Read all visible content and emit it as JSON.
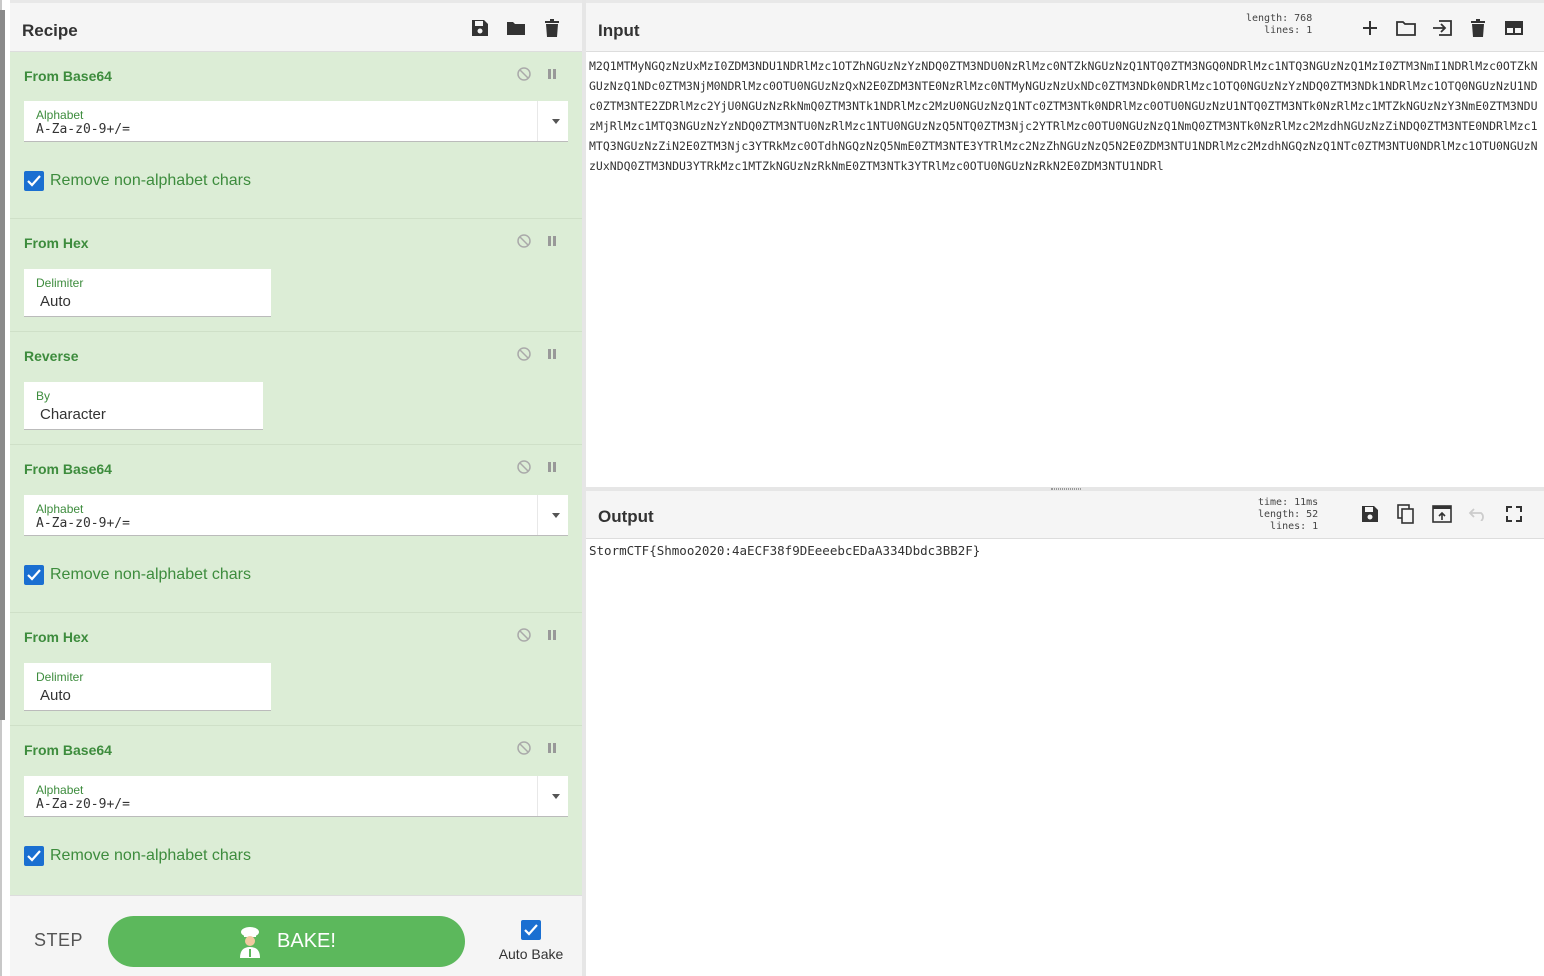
{
  "recipe": {
    "title": "Recipe",
    "operations": [
      {
        "name": "From Base64",
        "field_label": "Alphabet",
        "field_value": "A-Za-z0-9+/=",
        "checkbox_label": "Remove non-alphabet chars"
      },
      {
        "name": "From Hex",
        "field_label": "Delimiter",
        "field_value": "Auto"
      },
      {
        "name": "Reverse",
        "field_label": "By",
        "field_value": "Character"
      },
      {
        "name": "From Base64",
        "field_label": "Alphabet",
        "field_value": "A-Za-z0-9+/=",
        "checkbox_label": "Remove non-alphabet chars"
      },
      {
        "name": "From Hex",
        "field_label": "Delimiter",
        "field_value": "Auto"
      },
      {
        "name": "From Base64",
        "field_label": "Alphabet",
        "field_value": "A-Za-z0-9+/=",
        "checkbox_label": "Remove non-alphabet chars"
      }
    ],
    "step_label": "STEP",
    "bake_label": "BAKE!",
    "auto_bake_label": "Auto Bake",
    "auto_bake_checked": true
  },
  "input": {
    "title": "Input",
    "length_label": "length:",
    "length_value": "768",
    "lines_label": "lines:",
    "lines_value": "1",
    "text": "M2Q1MTMyNGQzNzUxMzI0ZDM3NDU1NDRlMzc1OTZhNGUzNzYzNDQ0ZTM3NDU0NzRlMzc0NTZkNGUzNzQ1NTQ0ZTM3NGQ0NDRlMzc1NTQ3NGUzNzQ1MzI0ZTM3NmI1NDRlMzc0OTZkNGUzNzQ1NDc0ZTM3NjM0NDRlMzc0OTU0NGUzNzQxN2E0ZDM3NTE0NzRlMzc0NTMyNGUzNzUxNDc0ZTM3NDk0NDRlMzc1OTQ0NGUzNzYzNDQ0ZTM3NDk1NDRlMzc1OTQ0NGUzNzU1NDc0ZTM3NTE2ZDRlMzc2YjU0NGUzNzRkNmQ0ZTM3NTk1NDRlMzc2MzU0NGUzNzQ1NTc0ZTM3NTk0NDRlMzc0OTU0NGUzNzU1NTQ0ZTM3NTk0NzRlMzc1MTZkNGUzNzY3NmE0ZTM3NDUzMjRlMzc1MTQ3NGUzNzYzNDQ0ZTM3NTU0NzRlMzc1NTU0NGUzNzQ5NTQ0ZTM3Njc2YTRlMzc0OTU0NGUzNzQ1NmQ0ZTM3NTk0NzRlMzc2MzdhNGUzNzZiNDQ0ZTM3NTE0NDRlMzc1MTQ3NGUzNzZiN2E0ZTM3Njc3YTRkMzc0OTdhNGQzNzQ5NmE0ZTM3NTE3YTRlMzc2NzZhNGUzNzQ5N2E0ZDM3NTU1NDRlMzc2MzdhNGQzNzQ1NTc0ZTM3NTU0NDRlMzc1OTU0NGUzNzUxNDQ0ZTM3NDU3YTRkMzc1MTZkNGUzNzRkNmE0ZTM3NTk3YTRlMzc0OTU0NGUzNzRkN2E0ZDM3NTU1NDRl"
  },
  "output": {
    "title": "Output",
    "time_label": "time:",
    "time_value": "11ms",
    "length_label": "length:",
    "length_value": "52",
    "lines_label": "lines:",
    "lines_value": "1",
    "text": "StormCTF{Shmoo2020:4aECF38f9DEeeebcEDaA334Dbdc3BB2F}"
  },
  "colors": {
    "accent_green": "#5cb85c",
    "op_background": "#dcedd6",
    "op_title": "#3d8c3d",
    "checkbox_blue": "#1a6fd1"
  },
  "icons": {
    "recipe_header": [
      "save-icon",
      "folder-icon",
      "trash-icon"
    ],
    "op_controls": [
      "disable-icon",
      "pause-icon"
    ],
    "input_header": [
      "plus-icon",
      "folder-icon",
      "import-icon",
      "trash-icon",
      "layout-icon"
    ],
    "output_header": [
      "save-icon",
      "copy-icon",
      "replace-input-icon",
      "undo-icon",
      "maximize-icon"
    ]
  }
}
